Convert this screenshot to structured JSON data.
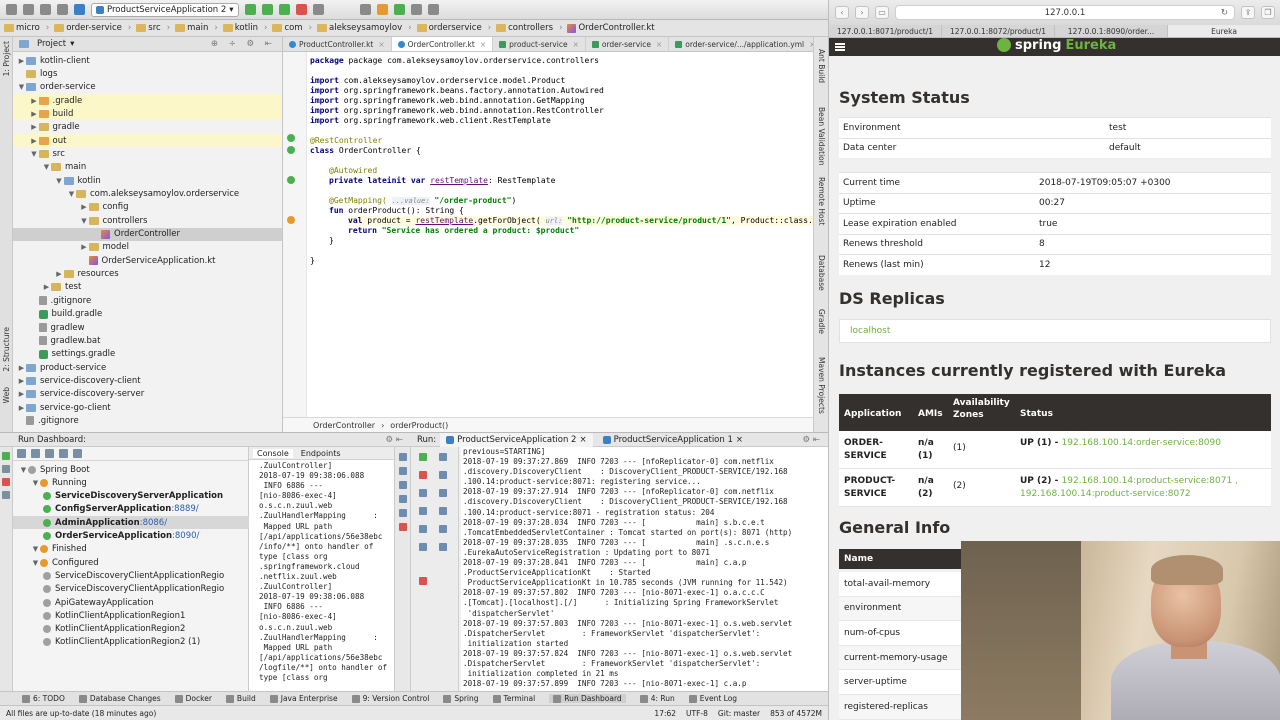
{
  "ide": {
    "run_config": "ProductServiceApplication 2",
    "breadcrumbs": [
      "micro",
      "order-service",
      "src",
      "main",
      "kotlin",
      "com",
      "alekseysamoylov",
      "orderservice",
      "controllers",
      "OrderController.kt"
    ],
    "project_label": "Project",
    "tree": [
      {
        "label": "kotlin-client",
        "depth": 1,
        "icon": "mod",
        "arrow": "▶"
      },
      {
        "label": "logs",
        "depth": 1,
        "icon": "folder",
        "arrow": ""
      },
      {
        "label": "order-service",
        "depth": 1,
        "icon": "mod",
        "arrow": "▼"
      },
      {
        "label": ".gradle",
        "depth": 2,
        "icon": "orange",
        "arrow": "▶",
        "hl": true
      },
      {
        "label": "build",
        "depth": 2,
        "icon": "orange",
        "arrow": "▶",
        "hl": true
      },
      {
        "label": "gradle",
        "depth": 2,
        "icon": "folder",
        "arrow": "▶"
      },
      {
        "label": "out",
        "depth": 2,
        "icon": "orange",
        "arrow": "▶",
        "hl": true
      },
      {
        "label": "src",
        "depth": 2,
        "icon": "folder",
        "arrow": "▼"
      },
      {
        "label": "main",
        "depth": 3,
        "icon": "folder",
        "arrow": "▼"
      },
      {
        "label": "kotlin",
        "depth": 4,
        "icon": "mod",
        "arrow": "▼"
      },
      {
        "label": "com.alekseysamoylov.orderservice",
        "depth": 5,
        "icon": "folder",
        "arrow": "▼"
      },
      {
        "label": "config",
        "depth": 6,
        "icon": "folder",
        "arrow": "▶"
      },
      {
        "label": "controllers",
        "depth": 6,
        "icon": "folder",
        "arrow": "▼"
      },
      {
        "label": "OrderController",
        "depth": 7,
        "icon": "kt",
        "arrow": "",
        "sel": true
      },
      {
        "label": "model",
        "depth": 6,
        "icon": "folder",
        "arrow": "▶"
      },
      {
        "label": "OrderServiceApplication.kt",
        "depth": 6,
        "icon": "kt",
        "arrow": ""
      },
      {
        "label": "resources",
        "depth": 4,
        "icon": "folder",
        "arrow": "▶"
      },
      {
        "label": "test",
        "depth": 3,
        "icon": "folder",
        "arrow": "▶"
      },
      {
        "label": ".gitignore",
        "depth": 2,
        "icon": "file",
        "arrow": ""
      },
      {
        "label": "build.gradle",
        "depth": 2,
        "icon": "gr",
        "arrow": ""
      },
      {
        "label": "gradlew",
        "depth": 2,
        "icon": "file",
        "arrow": ""
      },
      {
        "label": "gradlew.bat",
        "depth": 2,
        "icon": "file",
        "arrow": ""
      },
      {
        "label": "settings.gradle",
        "depth": 2,
        "icon": "gr",
        "arrow": ""
      },
      {
        "label": "product-service",
        "depth": 1,
        "icon": "mod",
        "arrow": "▶"
      },
      {
        "label": "service-discovery-client",
        "depth": 1,
        "icon": "mod",
        "arrow": "▶"
      },
      {
        "label": "service-discovery-server",
        "depth": 1,
        "icon": "mod",
        "arrow": "▶"
      },
      {
        "label": "service-go-client",
        "depth": 1,
        "icon": "mod",
        "arrow": "▶"
      },
      {
        "label": ".gitignore",
        "depth": 1,
        "icon": "file",
        "arrow": ""
      }
    ],
    "editor_tabs": [
      {
        "label": "ProductController.kt",
        "active": false,
        "kind": "k"
      },
      {
        "label": "OrderController.kt",
        "active": true,
        "kind": "k"
      },
      {
        "label": "product-service",
        "active": false,
        "kind": "gr"
      },
      {
        "label": "order-service",
        "active": false,
        "kind": "gr"
      },
      {
        "label": "order-service/.../application.yml",
        "active": false,
        "kind": "gr"
      }
    ],
    "code": {
      "l1": "package com.alekseysamoylov.orderservice.controllers",
      "i1": "com.alekseysamoylov.orderservice.model.Product",
      "i2": "org.springframework.beans.factory.annotation.Autowired",
      "i3": "org.springframework.web.bind.annotation.GetMapping",
      "i4": "org.springframework.web.bind.annotation.RestController",
      "i5": "org.springframework.web.client.RestTemplate",
      "a1": "@RestController",
      "cls": "OrderController {",
      "a2": "@Autowired",
      "field": "restTemplate",
      "field_type": ": RestTemplate",
      "gm": "@GetMapping(",
      "gm_hint": "...value:",
      "gm_path": "\"/order-product\"",
      "fun_name": "orderProduct(): String {",
      "val_name": "product = ",
      "call": ".getForObject(",
      "url_hint": "url:",
      "url": "\"http://product-service/product/1\"",
      "cls_ref": ", Product::class.java",
      "ret": "\"Service has ordered a product: $product\""
    },
    "editor_breadcrumb": [
      "OrderController",
      "orderProduct()"
    ],
    "right_tools": [
      "Ant Build",
      "Bean Validation",
      "Remote Host",
      "Database",
      "Gradle",
      "Maven Projects"
    ],
    "left_tools": [
      "1: Project",
      "2: Structure",
      "Web",
      "2: Favorites"
    ],
    "run_dashboard": {
      "title": "Run Dashboard:",
      "nodes": [
        {
          "label": "Spring Boot",
          "depth": 0,
          "kind": "group"
        },
        {
          "label": "Running",
          "depth": 1,
          "kind": "group"
        },
        {
          "label": "ServiceDiscoveryServerApplication",
          "port": "",
          "depth": 2,
          "kind": "run",
          "bold": true
        },
        {
          "label": "ConfigServerApplication",
          "port": ":8889/",
          "depth": 2,
          "kind": "run",
          "bold": true
        },
        {
          "label": "AdminApplication",
          "port": ":8086/",
          "depth": 2,
          "kind": "run",
          "bold": true,
          "sel": true
        },
        {
          "label": "OrderServiceApplication",
          "port": ":8090/",
          "depth": 2,
          "kind": "run",
          "bold": true
        },
        {
          "label": "Finished",
          "depth": 1,
          "kind": "group"
        },
        {
          "label": "Configured",
          "depth": 1,
          "kind": "group"
        },
        {
          "label": "ServiceDiscoveryClientApplicationRegio",
          "port": "",
          "depth": 2,
          "kind": "cfg"
        },
        {
          "label": "ServiceDiscoveryClientApplicationRegio",
          "port": "",
          "depth": 2,
          "kind": "cfg"
        },
        {
          "label": "ApiGatewayApplication",
          "port": "",
          "depth": 2,
          "kind": "cfg"
        },
        {
          "label": "KotlinClientApplicationRegion1",
          "port": "",
          "depth": 2,
          "kind": "cfg"
        },
        {
          "label": "KotlinClientApplicationRegion2",
          "port": "",
          "depth": 2,
          "kind": "cfg"
        },
        {
          "label": "KotlinClientApplicationRegion2 (1)",
          "port": "",
          "depth": 2,
          "kind": "cfg"
        }
      ]
    },
    "console_tabs": [
      "Console",
      "Endpoints"
    ],
    "console1": ".ZuulController]\n2018-07-19 09:38:06.088\n INFO 6886 ---\n[nio-8086-exec-4]\no.s.c.n.zuul.web\n.ZuulHandlerMapping      :\n Mapped URL path\n[/api/applications/56e38ebc\n/info/**] onto handler of\ntype [class org\n.springframework.cloud\n.netflix.zuul.web\n.ZuulController]\n2018-07-19 09:38:06.088\n INFO 6886 ---\n[nio-8086-exec-4]\no.s.c.n.zuul.web\n.ZuulHandlerMapping      :\n Mapped URL path\n[/api/applications/56e38ebc\n/logfile/**] onto handler of\ntype [class org",
    "run_label": "Run:",
    "run_tabs": [
      {
        "label": "ProductServiceApplication 2",
        "active": true
      },
      {
        "label": "ProductServiceApplication 1",
        "active": false
      }
    ],
    "console2": "previous=STARTING]\n2018-07-19 09:37:27.869  INFO 7203 --- [nfoReplicator-0] com.netflix\n.discovery.DiscoveryClient    : DiscoveryClient_PRODUCT-SERVICE/192.168\n.100.14:product-service:8071: registering service...\n2018-07-19 09:37:27.914  INFO 7203 --- [nfoReplicator-0] com.netflix\n.discovery.DiscoveryClient    : DiscoveryClient_PRODUCT-SERVICE/192.168\n.100.14:product-service:8071 - registration status: 204\n2018-07-19 09:37:28.034  INFO 7203 --- [           main] s.b.c.e.t\n.TomcatEmbeddedServletContainer : Tomcat started on port(s): 8071 (http)\n2018-07-19 09:37:28.035  INFO 7203 --- [           main] .s.c.n.e.s\n.EurekaAutoServiceRegistration : Updating port to 8071\n2018-07-19 09:37:28.041  INFO 7203 --- [           main] c.a.p\n.ProductServiceApplicationKt    : Started\n ProductServiceApplicationKt in 10.785 seconds (JVM running for 11.542)\n2018-07-19 09:37:57.802  INFO 7203 --- [nio-8071-exec-1] o.a.c.c.C\n.[Tomcat].[localhost].[/]      : Initializing Spring FrameworkServlet\n 'dispatcherServlet'\n2018-07-19 09:37:57.803  INFO 7203 --- [nio-8071-exec-1] o.s.web.servlet\n.DispatcherServlet        : FrameworkServlet 'dispatcherServlet':\n initialization started\n2018-07-19 09:37:57.824  INFO 7203 --- [nio-8071-exec-1] o.s.web.servlet\n.DispatcherServlet        : FrameworkServlet 'dispatcherServlet':\n initialization completed in 21 ms\n2018-07-19 09:37:57.899  INFO 7203 --- [nio-8071-exec-1] c.a.p",
    "tool_windows": [
      {
        "label": "6: TODO",
        "active": false
      },
      {
        "label": "Database Changes",
        "active": false
      },
      {
        "label": "Docker",
        "active": false
      },
      {
        "label": "Build",
        "active": false
      },
      {
        "label": "Java Enterprise",
        "active": false
      },
      {
        "label": "9: Version Control",
        "active": false
      },
      {
        "label": "Spring",
        "active": false
      },
      {
        "label": "Terminal",
        "active": false
      },
      {
        "label": "Run Dashboard",
        "active": true
      },
      {
        "label": "4: Run",
        "active": false
      },
      {
        "label": "Event Log",
        "active": false
      }
    ],
    "status_left": "All files are up-to-date (18 minutes ago)",
    "status_pos": "17:62",
    "status_enc": "UTF-8",
    "status_git": "Git: master",
    "status_mem": "853 of 4572M"
  },
  "browser": {
    "url": "127.0.0.1",
    "tabs": [
      {
        "label": "127.0.0.1:8071/product/1",
        "active": false
      },
      {
        "label": "127.0.0.1:8072/product/1",
        "active": false
      },
      {
        "label": "127.0.0.1:8090/order...",
        "active": false
      },
      {
        "label": "Eureka",
        "active": true
      }
    ],
    "brand_a": "spring",
    "brand_b": "Eureka",
    "system_status_title": "System Status",
    "status1": [
      {
        "k": "Environment",
        "v": "test"
      },
      {
        "k": "Data center",
        "v": "default"
      }
    ],
    "status2": [
      {
        "k": "Current time",
        "v": "2018-07-19T09:05:07 +0300"
      },
      {
        "k": "Uptime",
        "v": "00:27"
      },
      {
        "k": "Lease expiration enabled",
        "v": "true"
      },
      {
        "k": "Renews threshold",
        "v": "8"
      },
      {
        "k": "Renews (last min)",
        "v": "12"
      }
    ],
    "ds_title": "DS Replicas",
    "replica": "localhost",
    "instances_title": "Instances currently registered with Eureka",
    "inst_headers": [
      "Application",
      "AMIs",
      "Availability Zones",
      "Status"
    ],
    "instances": [
      {
        "app": "ORDER-SERVICE",
        "ami": "n/a (1)",
        "zones": "(1)",
        "up": "UP (1) - ",
        "links": "192.168.100.14:order-service:8090"
      },
      {
        "app": "PRODUCT-SERVICE",
        "ami": "n/a (2)",
        "zones": "(2)",
        "up": "UP (2) - ",
        "links": "192.168.100.14:product-service:8071 , 192.168.100.14:product-service:8072"
      }
    ],
    "general_title": "General Info",
    "general_header": "Name",
    "general": [
      "total-avail-memory",
      "environment",
      "num-of-cpus",
      "current-memory-usage",
      "server-uptime",
      "registered-replicas"
    ],
    "accent": "#6db33f",
    "dark": "#34302d"
  }
}
